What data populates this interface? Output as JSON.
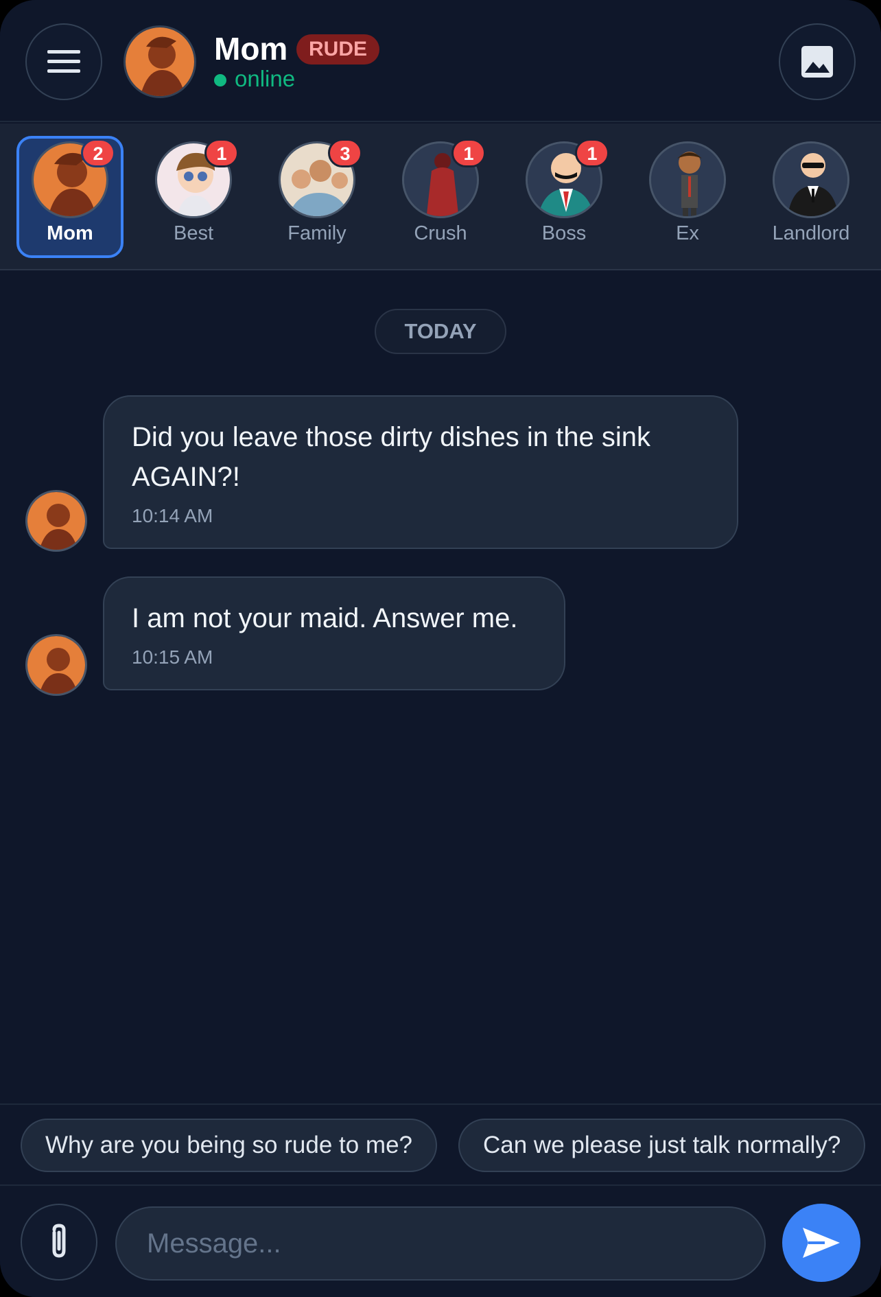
{
  "header": {
    "name": "Mom",
    "mood_badge": "RUDE",
    "status": "online",
    "icons": {
      "menu": "hamburger-menu-icon",
      "gallery": "image-icon"
    }
  },
  "contacts": [
    {
      "label": "Mom",
      "badge": "2",
      "active": true
    },
    {
      "label": "Best",
      "badge": "1"
    },
    {
      "label": "Family",
      "badge": "3"
    },
    {
      "label": "Crush",
      "badge": "1"
    },
    {
      "label": "Boss",
      "badge": "1"
    },
    {
      "label": "Ex",
      "badge": ""
    },
    {
      "label": "Landlord",
      "badge": ""
    }
  ],
  "chat": {
    "date_label": "TODAY",
    "messages": [
      {
        "text": "Did you leave those dirty dishes in the sink AGAIN?!",
        "time": "10:14 AM"
      },
      {
        "text": "I am not your maid. Answer me.",
        "time": "10:15 AM"
      }
    ]
  },
  "quick_replies": [
    "Why are you being so rude to me?",
    "Can we please just talk normally?"
  ],
  "composer": {
    "placeholder": "Message...",
    "icons": {
      "attach": "paperclip-icon",
      "send": "send-icon"
    }
  },
  "colors": {
    "background": "#0f172a",
    "accent": "#3b82f6",
    "online": "#10b981",
    "badge": "#ef4444",
    "mood_badge_bg": "#7f1d1d"
  }
}
